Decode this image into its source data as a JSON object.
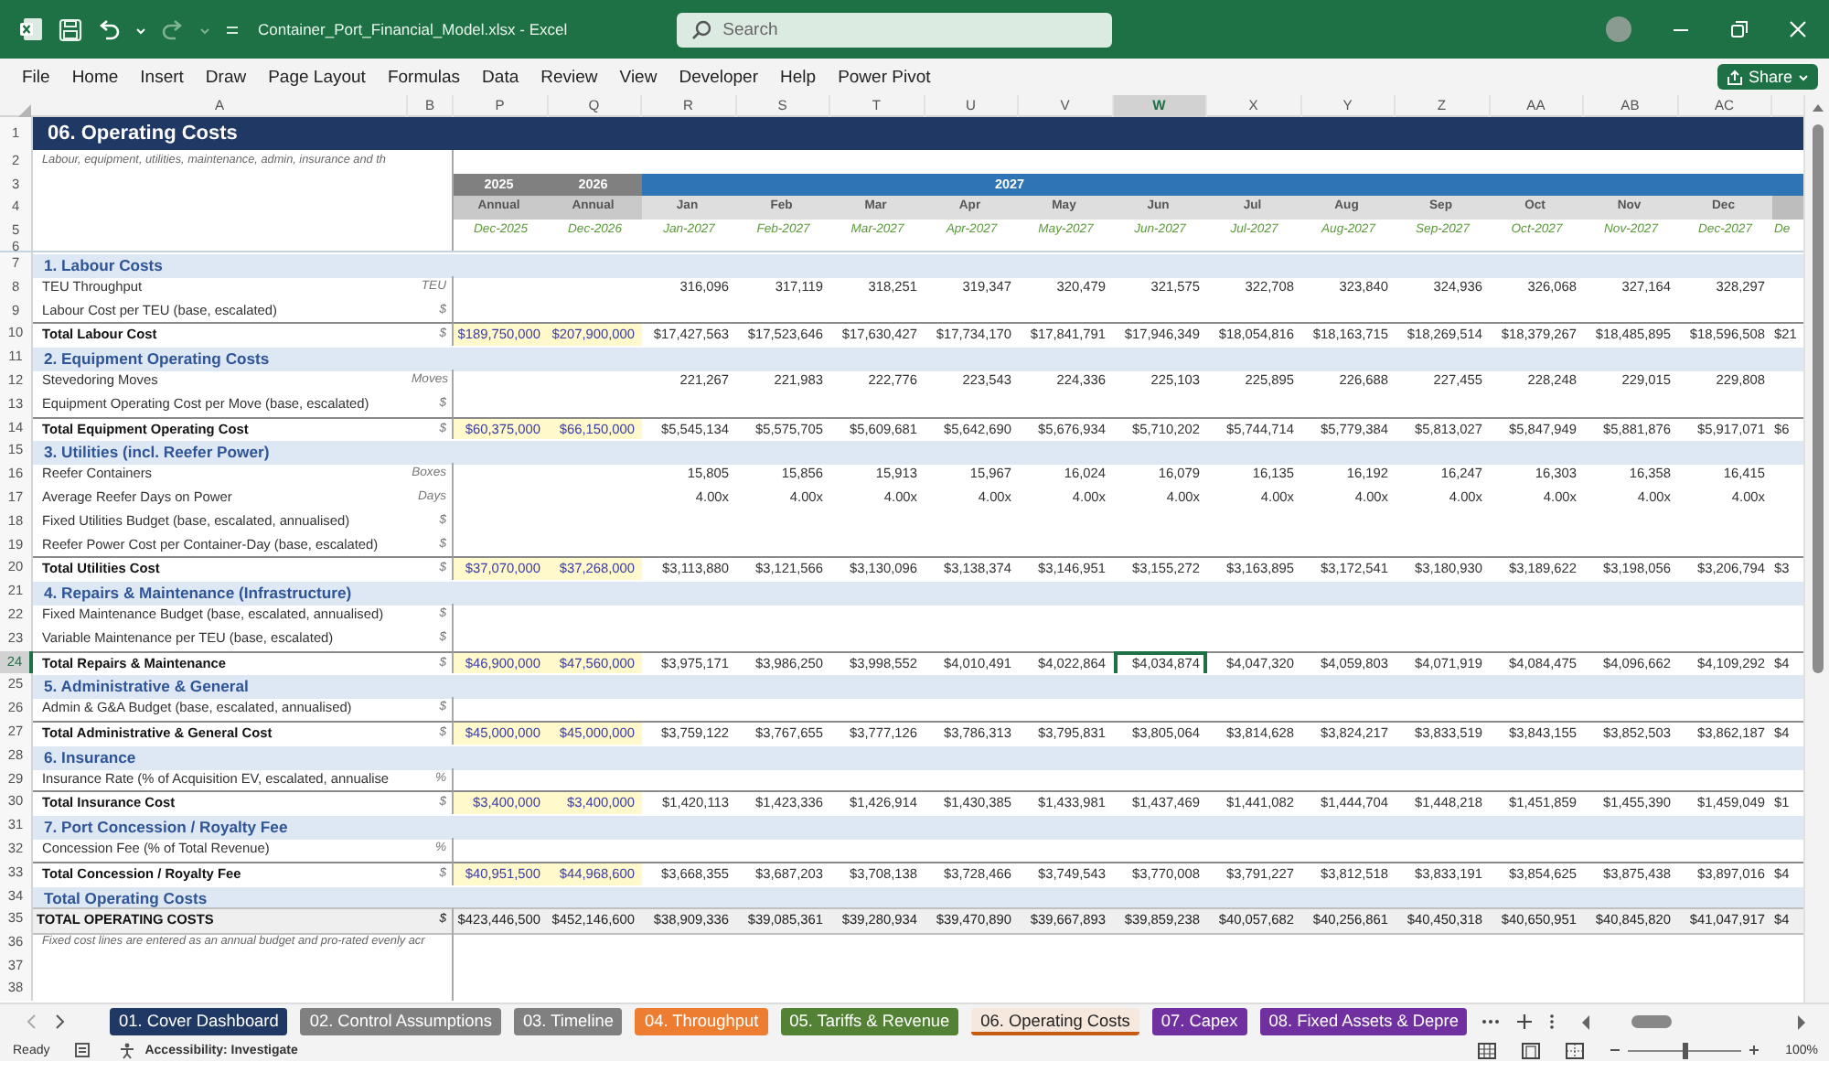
{
  "window": {
    "title": "Container_Port_Financial_Model.xlsx  -  Excel",
    "search": {
      "placeholder": "Search"
    }
  },
  "menu": [
    "File",
    "Home",
    "Insert",
    "Draw",
    "Page Layout",
    "Formulas",
    "Data",
    "Review",
    "View",
    "Developer",
    "Help",
    "Power Pivot"
  ],
  "share_button": "Share",
  "columns": [
    {
      "label": "A",
      "selected": false
    },
    {
      "label": "B",
      "selected": false
    },
    {
      "label": "P",
      "selected": false
    },
    {
      "label": "Q",
      "selected": false
    },
    {
      "label": "R",
      "selected": false
    },
    {
      "label": "S",
      "selected": false
    },
    {
      "label": "T",
      "selected": false
    },
    {
      "label": "U",
      "selected": false
    },
    {
      "label": "V",
      "selected": false
    },
    {
      "label": "W",
      "selected": true
    },
    {
      "label": "X",
      "selected": false
    },
    {
      "label": "Y",
      "selected": false
    },
    {
      "label": "Z",
      "selected": false
    },
    {
      "label": "AA",
      "selected": false
    },
    {
      "label": "AB",
      "selected": false
    },
    {
      "label": "AC",
      "selected": false
    }
  ],
  "rows": [
    {
      "number": "1",
      "kind": "title",
      "selected": false,
      "label": "06. Operating Costs"
    },
    {
      "number": "2",
      "kind": "note",
      "selected": false,
      "label": "Labour, equipment, utilities, maintenance, admin, insurance and th"
    },
    {
      "number": "3",
      "kind": "years",
      "selected": false,
      "annual": [
        "2025",
        "2026"
      ],
      "band": "2027"
    },
    {
      "number": "4",
      "kind": "periods",
      "selected": false,
      "annual": [
        "Annual",
        "Annual"
      ],
      "monthly": [
        "Jan",
        "Feb",
        "Mar",
        "Apr",
        "May",
        "Jun",
        "Jul",
        "Aug",
        "Sep",
        "Oct",
        "Nov",
        "Dec"
      ]
    },
    {
      "number": "5",
      "kind": "dates",
      "selected": false,
      "annual": [
        "Dec-2025",
        "Dec-2026"
      ],
      "monthly": [
        "Jan-2027",
        "Feb-2027",
        "Mar-2027",
        "Apr-2027",
        "May-2027",
        "Jun-2027",
        "Jul-2027",
        "Aug-2027",
        "Sep-2027",
        "Oct-2027",
        "Nov-2027",
        "Dec-2027"
      ],
      "partial": "De"
    },
    {
      "number": "6",
      "kind": "spacer",
      "selected": false
    },
    {
      "number": "7",
      "kind": "section",
      "selected": false,
      "label": "1. Labour Costs"
    },
    {
      "number": "8",
      "kind": "line",
      "selected": false,
      "label": "TEU Throughput",
      "unit": "TEU",
      "monthly": [
        "316,096",
        "317,119",
        "318,251",
        "319,347",
        "320,479",
        "321,575",
        "322,708",
        "323,840",
        "324,936",
        "326,068",
        "327,164",
        "328,297"
      ]
    },
    {
      "number": "9",
      "kind": "line",
      "selected": false,
      "label": "Labour Cost per TEU (base, escalated)",
      "unit": "$"
    },
    {
      "number": "10",
      "kind": "total",
      "selected": false,
      "label": "Total Labour Cost",
      "unit": "$",
      "annual": [
        "$189,750,000",
        "$207,900,000"
      ],
      "monthly": [
        "$17,427,563",
        "$17,523,646",
        "$17,630,427",
        "$17,734,170",
        "$17,841,791",
        "$17,946,349",
        "$18,054,816",
        "$18,163,715",
        "$18,269,514",
        "$18,379,267",
        "$18,485,895",
        "$18,596,508"
      ],
      "partial": "$21"
    },
    {
      "number": "11",
      "kind": "section",
      "selected": false,
      "label": "2. Equipment Operating Costs"
    },
    {
      "number": "12",
      "kind": "line",
      "selected": false,
      "label": "Stevedoring Moves",
      "unit": "Moves",
      "monthly": [
        "221,267",
        "221,983",
        "222,776",
        "223,543",
        "224,336",
        "225,103",
        "225,895",
        "226,688",
        "227,455",
        "228,248",
        "229,015",
        "229,808"
      ]
    },
    {
      "number": "13",
      "kind": "line",
      "selected": false,
      "label": "Equipment Operating Cost per Move (base, escalated)",
      "unit": "$"
    },
    {
      "number": "14",
      "kind": "total",
      "selected": false,
      "label": "Total Equipment Operating Cost",
      "unit": "$",
      "annual": [
        "$60,375,000",
        "$66,150,000"
      ],
      "monthly": [
        "$5,545,134",
        "$5,575,705",
        "$5,609,681",
        "$5,642,690",
        "$5,676,934",
        "$5,710,202",
        "$5,744,714",
        "$5,779,384",
        "$5,813,027",
        "$5,847,949",
        "$5,881,876",
        "$5,917,071"
      ],
      "partial": "$6"
    },
    {
      "number": "15",
      "kind": "section",
      "selected": false,
      "label": "3. Utilities (incl. Reefer Power)"
    },
    {
      "number": "16",
      "kind": "line",
      "selected": false,
      "label": "Reefer Containers",
      "unit": "Boxes",
      "monthly": [
        "15,805",
        "15,856",
        "15,913",
        "15,967",
        "16,024",
        "16,079",
        "16,135",
        "16,192",
        "16,247",
        "16,303",
        "16,358",
        "16,415"
      ]
    },
    {
      "number": "17",
      "kind": "line",
      "selected": false,
      "label": "Average Reefer Days on Power",
      "unit": "Days",
      "monthly": [
        "4.00x",
        "4.00x",
        "4.00x",
        "4.00x",
        "4.00x",
        "4.00x",
        "4.00x",
        "4.00x",
        "4.00x",
        "4.00x",
        "4.00x",
        "4.00x"
      ]
    },
    {
      "number": "18",
      "kind": "line",
      "selected": false,
      "label": "Fixed Utilities Budget (base, escalated, annualised)",
      "unit": "$"
    },
    {
      "number": "19",
      "kind": "line",
      "selected": false,
      "label": "Reefer Power Cost per Container-Day (base, escalated)",
      "unit": "$"
    },
    {
      "number": "20",
      "kind": "total",
      "selected": false,
      "label": "Total Utilities Cost",
      "unit": "$",
      "annual": [
        "$37,070,000",
        "$37,268,000"
      ],
      "monthly": [
        "$3,113,880",
        "$3,121,566",
        "$3,130,096",
        "$3,138,374",
        "$3,146,951",
        "$3,155,272",
        "$3,163,895",
        "$3,172,541",
        "$3,180,930",
        "$3,189,622",
        "$3,198,056",
        "$3,206,794"
      ],
      "partial": "$3"
    },
    {
      "number": "21",
      "kind": "section",
      "selected": false,
      "label": "4. Repairs & Maintenance (Infrastructure)"
    },
    {
      "number": "22",
      "kind": "line",
      "selected": false,
      "label": "Fixed Maintenance Budget (base, escalated, annualised)",
      "unit": "$"
    },
    {
      "number": "23",
      "kind": "line",
      "selected": false,
      "label": "Variable Maintenance per TEU (base, escalated)",
      "unit": "$"
    },
    {
      "number": "24",
      "kind": "total",
      "selected": true,
      "label": "Total Repairs & Maintenance",
      "unit": "$",
      "annual": [
        "$46,900,000",
        "$47,560,000"
      ],
      "monthly": [
        "$3,975,171",
        "$3,986,250",
        "$3,998,552",
        "$4,010,491",
        "$4,022,864",
        "$4,034,874",
        "$4,047,320",
        "$4,059,803",
        "$4,071,919",
        "$4,084,475",
        "$4,096,662",
        "$4,109,292"
      ],
      "partial": "$4"
    },
    {
      "number": "25",
      "kind": "section",
      "selected": false,
      "label": "5. Administrative & General"
    },
    {
      "number": "26",
      "kind": "line",
      "selected": false,
      "label": "Admin & G&A Budget (base, escalated, annualised)",
      "unit": "$"
    },
    {
      "number": "27",
      "kind": "total",
      "selected": false,
      "label": "Total Administrative & General Cost",
      "unit": "$",
      "annual": [
        "$45,000,000",
        "$45,000,000"
      ],
      "monthly": [
        "$3,759,122",
        "$3,767,655",
        "$3,777,126",
        "$3,786,313",
        "$3,795,831",
        "$3,805,064",
        "$3,814,628",
        "$3,824,217",
        "$3,833,519",
        "$3,843,155",
        "$3,852,503",
        "$3,862,187"
      ],
      "partial": "$4"
    },
    {
      "number": "28",
      "kind": "section",
      "selected": false,
      "label": "6. Insurance"
    },
    {
      "number": "29",
      "kind": "line",
      "selected": false,
      "label": "Insurance Rate (% of Acquisition EV, escalated, annualise",
      "unit": "%"
    },
    {
      "number": "30",
      "kind": "total",
      "selected": false,
      "label": "Total Insurance Cost",
      "unit": "$",
      "annual": [
        "$3,400,000",
        "$3,400,000"
      ],
      "monthly": [
        "$1,420,113",
        "$1,423,336",
        "$1,426,914",
        "$1,430,385",
        "$1,433,981",
        "$1,437,469",
        "$1,441,082",
        "$1,444,704",
        "$1,448,218",
        "$1,451,859",
        "$1,455,390",
        "$1,459,049"
      ],
      "partial": "$1"
    },
    {
      "number": "31",
      "kind": "section",
      "selected": false,
      "label": "7. Port Concession / Royalty Fee"
    },
    {
      "number": "32",
      "kind": "line",
      "selected": false,
      "label": "Concession Fee (% of Total Revenue)",
      "unit": "%"
    },
    {
      "number": "33",
      "kind": "total",
      "selected": false,
      "label": "Total Concession / Royalty Fee",
      "unit": "$",
      "annual": [
        "$40,951,500",
        "$44,968,600"
      ],
      "monthly": [
        "$3,668,355",
        "$3,687,203",
        "$3,708,138",
        "$3,728,466",
        "$3,749,543",
        "$3,770,008",
        "$3,791,227",
        "$3,812,518",
        "$3,833,191",
        "$3,854,625",
        "$3,875,438",
        "$3,897,016"
      ],
      "partial": "$4"
    },
    {
      "number": "34",
      "kind": "section",
      "selected": false,
      "label": "Total Operating Costs"
    },
    {
      "number": "35",
      "kind": "grand",
      "selected": false,
      "label": "TOTAL OPERATING COSTS",
      "unit": "$",
      "annual": [
        "$423,446,500",
        "$452,146,600"
      ],
      "monthly": [
        "$38,909,336",
        "$39,085,361",
        "$39,280,934",
        "$39,470,890",
        "$39,667,893",
        "$39,859,238",
        "$40,057,682",
        "$40,256,861",
        "$40,450,318",
        "$40,650,951",
        "$40,845,820",
        "$41,047,917"
      ],
      "partial": "$4"
    },
    {
      "number": "36",
      "kind": "note",
      "selected": false,
      "label": "Fixed cost lines are entered as an annual budget and pro-rated evenly acr"
    },
    {
      "number": "37",
      "kind": "blank",
      "selected": false
    },
    {
      "number": "38",
      "kind": "blank",
      "selected": false
    }
  ],
  "sheet_tabs": [
    {
      "label": "01. Cover Dashboard",
      "color": "#203864",
      "selected": false
    },
    {
      "label": "02. Control Assumptions",
      "color": "#808080",
      "selected": false
    },
    {
      "label": "03. Timeline",
      "color": "#808080",
      "selected": false
    },
    {
      "label": "04. Throughput",
      "color": "#ed7d31",
      "selected": false
    },
    {
      "label": "05. Tariffs & Revenue",
      "color": "#548235",
      "selected": false
    },
    {
      "label": "06. Operating Costs",
      "color": "#c55a11",
      "selected": true
    },
    {
      "label": "07. Capex",
      "color": "#7030a0",
      "selected": false
    },
    {
      "label": "08. Fixed Assets & Depre",
      "color": "#7030a0",
      "selected": false
    }
  ],
  "status": {
    "mode": "Ready",
    "accessibility": "Accessibility: Investigate",
    "zoom": {
      "level": 0.5
    },
    "zoom_label": "100%"
  }
}
